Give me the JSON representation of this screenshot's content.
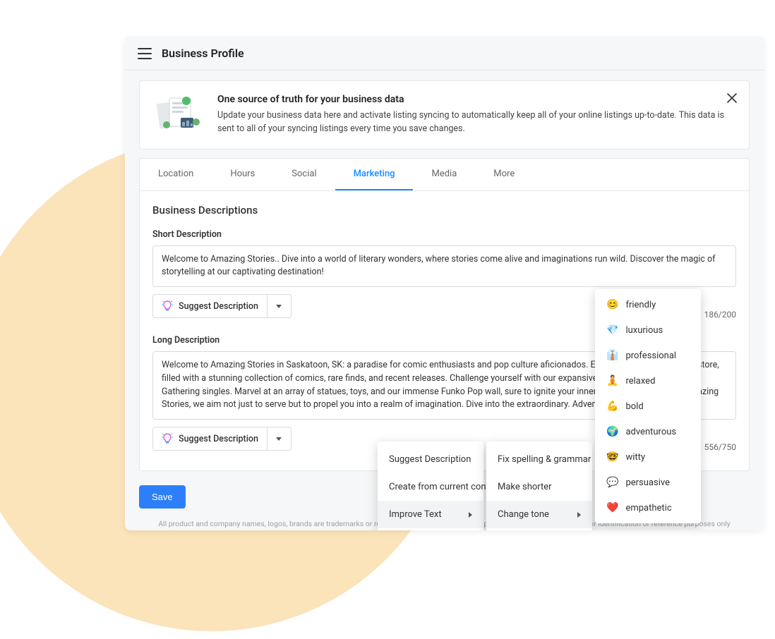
{
  "header": {
    "title": "Business Profile"
  },
  "banner": {
    "title": "One source of truth for your business data",
    "body": "Update your business data here and activate listing syncing to automatically keep all of your online listings up-to-date. This data is sent to all of your syncing listings every time you save changes."
  },
  "tabs": {
    "location": "Location",
    "hours": "Hours",
    "social": "Social",
    "marketing": "Marketing",
    "media": "Media",
    "more": "More"
  },
  "panel_title": "Business Descriptions",
  "short": {
    "label": "Short Description",
    "value": "Welcome to Amazing Stories.. Dive into a world of literary wonders, where stories come alive and imaginations run wild. Discover the magic of storytelling at our captivating destination!",
    "counter": "186/200"
  },
  "long": {
    "label": "Long Description",
    "value": "Welcome to Amazing Stories in Saskatoon, SK: a paradise for comic enthusiasts and pop culture aficionados. Explore our vast 4000 sq ft store, filled with a stunning collection of comics, rare finds, and recent releases. Challenge yourself with our expansive Pokemon and Magic the Gathering singles. Marvel at an array of statues, toys, and our immense Funko Pop wall, sure to ignite your inner child's excitement. At Amazing Stories, we aim not just to serve but to propel you into a realm of imagination. Dive into the extraordinary. Adventure awaits!",
    "counter": "556/750"
  },
  "suggest_label": "Suggest Description",
  "save_label": "Save",
  "disclaimer": "All product and company names, logos, brands are trademarks or registered trademarks of their respective holders. Use of them is for identification or reference purposes only and does not imply any affiliation, association, or endorsement by them.",
  "menus": {
    "primary": {
      "suggest": "Suggest Description",
      "create": "Create from current content",
      "improve": "Improve Text"
    },
    "improve": {
      "fix": "Fix spelling & grammar",
      "shorter": "Make shorter",
      "tone": "Change tone"
    },
    "tones": {
      "friendly": "friendly",
      "luxurious": "luxurious",
      "professional": "professional",
      "relaxed": "relaxed",
      "bold": "bold",
      "adventurous": "adventurous",
      "witty": "witty",
      "persuasive": "persuasive",
      "empathetic": "empathetic"
    },
    "tone_emojis": {
      "friendly": "😊",
      "luxurious": "💎",
      "professional": "👔",
      "relaxed": "🧘",
      "bold": "💪",
      "adventurous": "🌍",
      "witty": "🤓",
      "persuasive": "💬",
      "empathetic": "❤️"
    }
  }
}
